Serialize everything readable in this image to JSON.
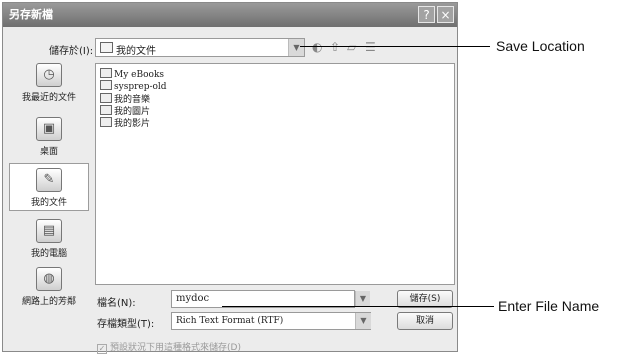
{
  "dialog": {
    "title": "另存新檔",
    "help_button": "?",
    "close_button": "×"
  },
  "savein": {
    "label": "儲存於(I):",
    "value": "我的文件"
  },
  "places": [
    {
      "label": "我最近的文件",
      "icon": "recent-documents-icon",
      "glyph": "◷"
    },
    {
      "label": "桌面",
      "icon": "desktop-icon",
      "glyph": "▣"
    },
    {
      "label": "我的文件",
      "icon": "my-documents-icon",
      "glyph": "✎"
    },
    {
      "label": "我的電腦",
      "icon": "my-computer-icon",
      "glyph": "▤"
    },
    {
      "label": "網路上的芳鄰",
      "icon": "network-icon",
      "glyph": "◍"
    }
  ],
  "files": [
    "My eBooks",
    "sysprep-old",
    "我的音樂",
    "我的圖片",
    "我的影片"
  ],
  "filename": {
    "label": "檔名(N):",
    "value": "mydoc"
  },
  "filetype": {
    "label": "存檔類型(T):",
    "value": "Rich Text Format (RTF)"
  },
  "buttons": {
    "save": "儲存(S)",
    "cancel": "取消"
  },
  "checkbox": {
    "label": "預設狀況下用這種格式來儲存(D)",
    "checked": true
  },
  "annotations": {
    "save_location": "Save Location",
    "enter_file_name": "Enter File Name"
  }
}
